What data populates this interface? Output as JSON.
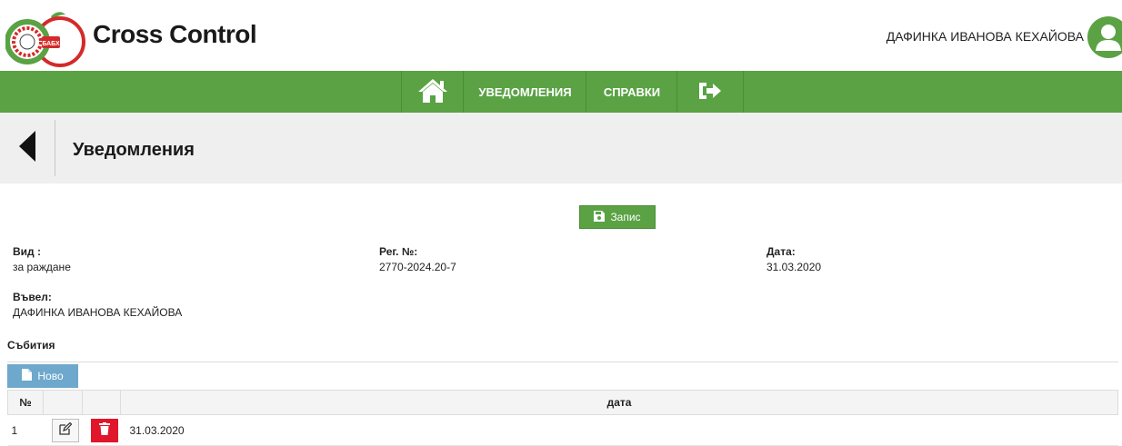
{
  "app": {
    "title": "Cross Control",
    "logo_text": "БАБХ",
    "user_name": "ДАФИНКА ИВАНОВА КЕХАЙОВА",
    "brand_color": "#5aa244"
  },
  "nav": {
    "items": [
      {
        "icon": "home-icon"
      },
      {
        "label": "УВЕДОМЛЕНИЯ"
      },
      {
        "label": "СПРАВКИ"
      },
      {
        "icon": "logout-icon"
      }
    ]
  },
  "page": {
    "title": "Уведомления",
    "save_label": "Запис"
  },
  "fields": {
    "type_label": "Вид :",
    "type_value": "за раждане",
    "reg_label": "Рег. №:",
    "reg_value": "2770-2024.20-7",
    "date_label": "Дата:",
    "date_value": "31.03.2020",
    "entered_label": "Въвел:",
    "entered_value": "ДАФИНКА ИВАНОВА КЕХАЙОВА"
  },
  "events": {
    "section_label": "Събития",
    "new_label": "Ново",
    "columns": [
      "№",
      "",
      "",
      "дата"
    ],
    "rows": [
      {
        "num": "1",
        "date": "31.03.2020"
      }
    ]
  }
}
